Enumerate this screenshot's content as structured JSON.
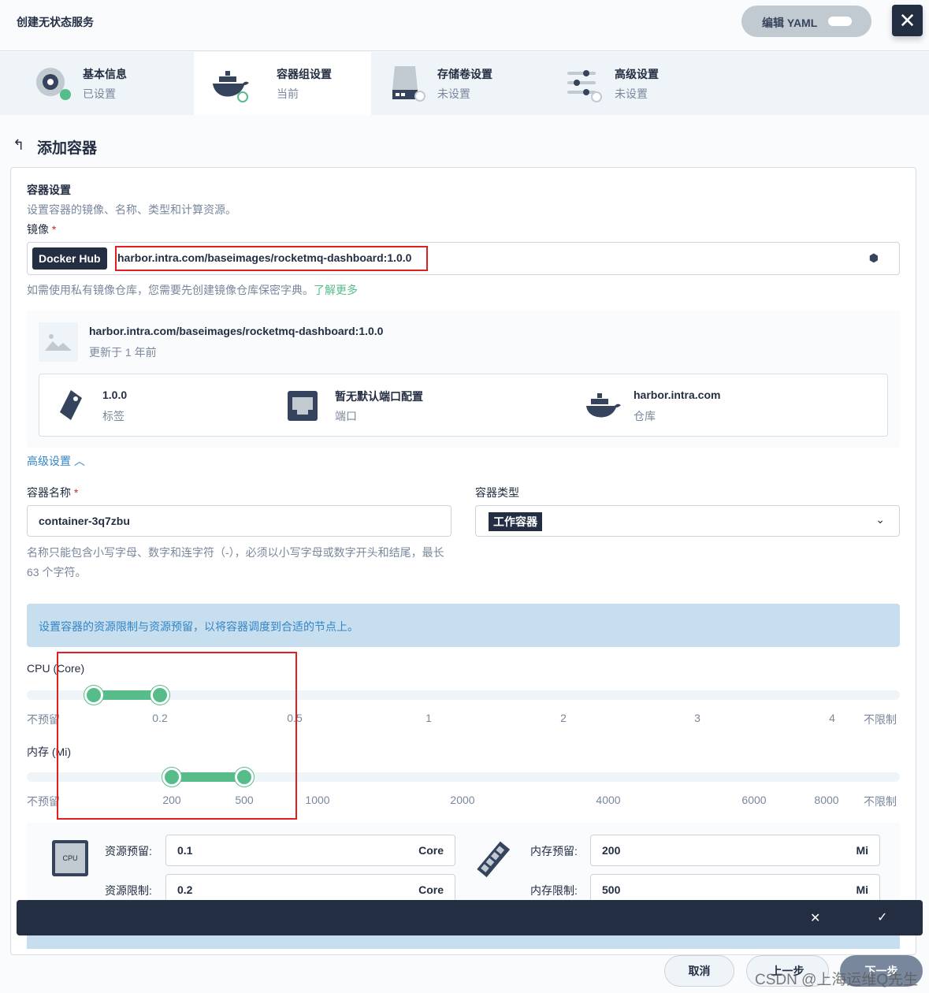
{
  "header": {
    "title": "创建无状态服务",
    "edit_yaml": "编辑 YAML"
  },
  "steps": [
    {
      "title": "基本信息",
      "status": "已设置",
      "icon": "info-icon"
    },
    {
      "title": "容器组设置",
      "status": "当前",
      "icon": "docker-icon"
    },
    {
      "title": "存储卷设置",
      "status": "未设置",
      "icon": "storage-icon"
    },
    {
      "title": "高级设置",
      "status": "未设置",
      "icon": "sliders-icon"
    }
  ],
  "page_title": "添加容器",
  "section": {
    "title": "容器设置",
    "desc": "设置容器的镜像、名称、类型和计算资源。"
  },
  "image": {
    "label": "镜像",
    "required": "*",
    "registry": "Docker Hub",
    "value": "harbor.intra.com/baseimages/rocketmq-dashboard:1.0.0",
    "hint": "如需使用私有镜像仓库，您需要先创建镜像仓库保密字典。",
    "learn_more": "了解更多"
  },
  "image_info": {
    "name": "harbor.intra.com/baseimages/rocketmq-dashboard:1.0.0",
    "updated": "更新于 1 年前",
    "tag": {
      "value": "1.0.0",
      "label": "标签"
    },
    "port": {
      "value": "暂无默认端口配置",
      "label": "端口"
    },
    "repo": {
      "value": "harbor.intra.com",
      "label": "仓库"
    }
  },
  "advanced_toggle": "高级设置",
  "container_name": {
    "label": "容器名称",
    "required": "*",
    "value": "container-3q7zbu",
    "hint": "名称只能包含小写字母、数字和连字符（-），必须以小写字母或数字开头和结尾，最长 63 个字符。"
  },
  "container_type": {
    "label": "容器类型",
    "value": "工作容器"
  },
  "resource_tip": "设置容器的资源限制与资源预留，以将容器调度到合适的节点上。",
  "cpu_slider": {
    "label": "CPU (Core)",
    "ticks": [
      "不预留",
      "0.2",
      "0.5",
      "1",
      "2",
      "3",
      "4",
      "不限制"
    ],
    "request": 0.1,
    "limit": 0.2
  },
  "mem_slider": {
    "label": "内存 (Mi)",
    "ticks": [
      "不预留",
      "200",
      "500",
      "1000",
      "2000",
      "4000",
      "6000",
      "8000",
      "不限制"
    ],
    "request": 200,
    "limit": 500
  },
  "resources": {
    "cpu_request_label": "资源预留:",
    "cpu_request": "0.1",
    "cpu_limit_label": "资源限制:",
    "cpu_limit": "0.2",
    "cpu_unit": "Core",
    "cpu_icon_text": "CPU",
    "mem_request_label": "内存预留:",
    "mem_request": "200",
    "mem_limit_label": "内存限制:",
    "mem_limit": "500",
    "mem_unit": "Mi"
  },
  "footer": {
    "cancel": "取消",
    "prev": "上一步",
    "next": "下一步",
    "watermark": "CSDN @上海运维Q先生"
  },
  "colors": {
    "accent": "#55bc8a",
    "dark": "#242e42",
    "annotation": "#e02020",
    "tip_bg": "#c7deef"
  }
}
